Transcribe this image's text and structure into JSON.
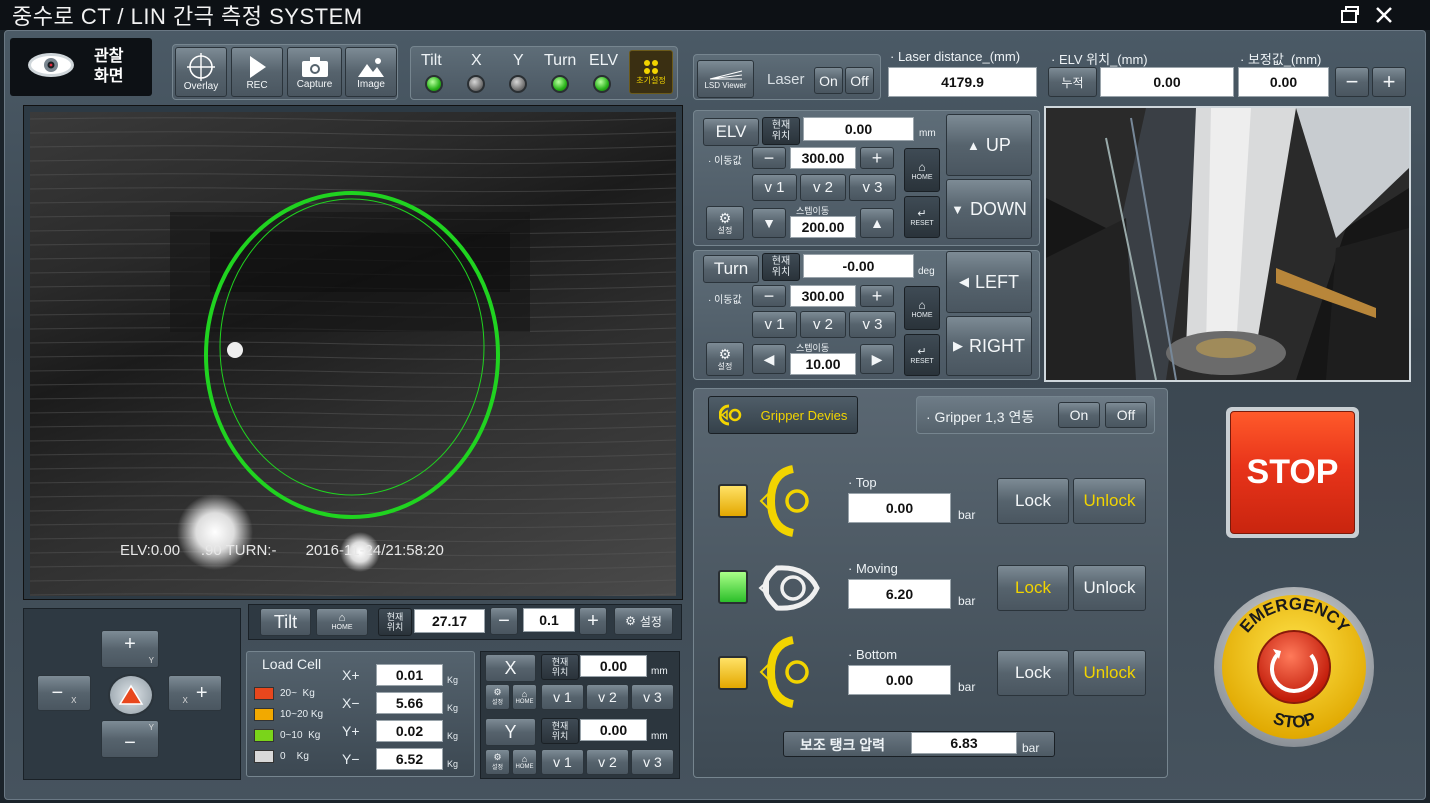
{
  "app": {
    "title": "중수로 CT / LIN 간극 측정 SYSTEM"
  },
  "toolbar": {
    "mode_label": "관찰\n화면",
    "mode_l1": "관찰",
    "mode_l2": "화면",
    "overlay": "Overlay",
    "rec": "REC",
    "capture": "Capture",
    "image": "Image"
  },
  "indicators": {
    "tilt": "Tilt",
    "x": "X",
    "y": "Y",
    "turn": "Turn",
    "elv": "ELV",
    "reset": "초기설정"
  },
  "laser": {
    "viewer": "LSD Viewer",
    "label": "Laser",
    "on": "On",
    "off": "Off"
  },
  "readouts": {
    "laser_distance_label": "· Laser distance_(mm)",
    "laser_distance": "4179.9",
    "elv_pos_label": "· ELV 위치_(mm)",
    "cumulative": "누적",
    "elv_pos": "0.00",
    "correction_label": "· 보정값_(mm)",
    "correction": "0.00",
    "minus": "−",
    "plus": "+"
  },
  "camera": {
    "overlay_text": "ELV:0.00     .90 TURN:-       2016-11-24/21:58:20"
  },
  "elv": {
    "name": "ELV",
    "cur_l1": "현재",
    "cur_l2": "위치",
    "current": "0.00",
    "unit": "mm",
    "move_label": "· 이동값",
    "move_value": "300.00",
    "v1": "v 1",
    "v2": "v 2",
    "v3": "v 3",
    "settings": "설정",
    "step_label": "스텝이동",
    "step_value": "200.00",
    "home": "HOME",
    "reset": "RESET",
    "up": "UP",
    "down": "DOWN"
  },
  "turn": {
    "name": "Turn",
    "cur_l1": "현재",
    "cur_l2": "위치",
    "current": "-0.00",
    "unit": "deg",
    "move_label": "· 이동값",
    "move_value": "300.00",
    "v1": "v 1",
    "v2": "v 2",
    "v3": "v 3",
    "settings": "설정",
    "step_label": "스텝이동",
    "step_value": "10.00",
    "home": "HOME",
    "reset": "RESET",
    "left": "LEFT",
    "right": "RIGHT"
  },
  "gripper": {
    "device_label": "Gripper Devies",
    "link_label": "· Gripper 1,3 연동",
    "on": "On",
    "off": "Off",
    "rows": [
      {
        "name": "· Top",
        "value": "0.00",
        "unit": "bar",
        "lock": "Lock",
        "unlock": "Unlock"
      },
      {
        "name": "· Moving",
        "value": "6.20",
        "unit": "bar",
        "lock": "Lock",
        "unlock": "Unlock"
      },
      {
        "name": "· Bottom",
        "value": "0.00",
        "unit": "bar",
        "lock": "Lock",
        "unlock": "Unlock"
      }
    ],
    "aux_label": "보조 탱크 압력",
    "aux_value": "6.83",
    "aux_unit": "bar"
  },
  "stop": {
    "label": "STOP",
    "emergency_top": "EMERGENCY",
    "emergency_bottom": "STOP"
  },
  "tilt": {
    "name": "Tilt",
    "home": "HOME",
    "cur_l1": "현재",
    "cur_l2": "위치",
    "current": "27.17",
    "minus": "−",
    "step": "0.1",
    "plus": "+",
    "settings": "설정"
  },
  "dpad": {
    "plus": "+",
    "minus": "−",
    "y": "Y",
    "x": "X"
  },
  "loadcell": {
    "title": "Load Cell",
    "legend": [
      {
        "color": "#e8471d",
        "text": "20~  Kg"
      },
      {
        "color": "#f2a900",
        "text": "10~20 Kg"
      },
      {
        "color": "#7ad41a",
        "text": "0~10  Kg"
      },
      {
        "color": "#d9d9d9",
        "text": "0    Kg"
      }
    ],
    "rows": [
      {
        "label": "X+",
        "value": "0.01",
        "unit": "Kg"
      },
      {
        "label": "X−",
        "value": "5.66",
        "unit": "Kg"
      },
      {
        "label": "Y+",
        "value": "0.02",
        "unit": "Kg"
      },
      {
        "label": "Y−",
        "value": "6.52",
        "unit": "Kg"
      }
    ]
  },
  "xy": {
    "x": {
      "name": "X",
      "cur_l1": "현재",
      "cur_l2": "위치",
      "current": "0.00",
      "unit": "mm",
      "settings": "설정",
      "home": "HOME",
      "v1": "v 1",
      "v2": "v 2",
      "v3": "v 3"
    },
    "y": {
      "name": "Y",
      "cur_l1": "현재",
      "cur_l2": "위치",
      "current": "0.00",
      "unit": "mm",
      "settings": "설정",
      "home": "HOME",
      "v1": "v 1",
      "v2": "v 2",
      "v3": "v 3"
    }
  }
}
